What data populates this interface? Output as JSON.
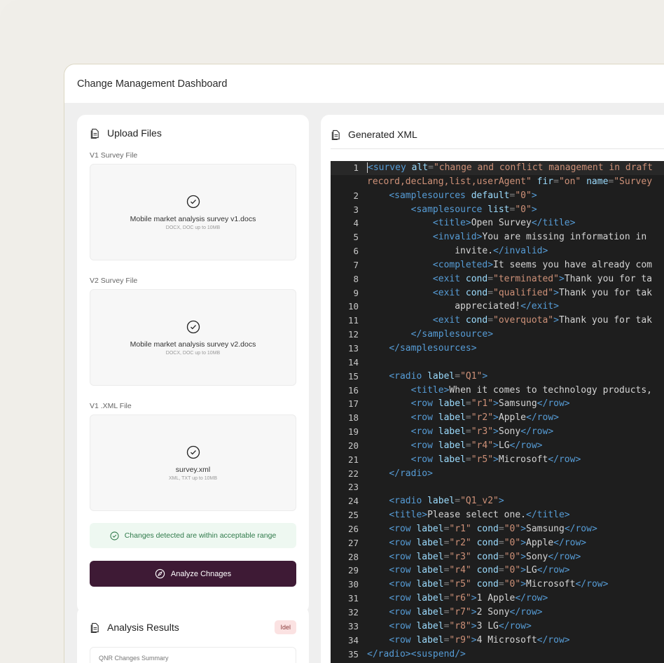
{
  "app": {
    "title": "Change Management Dashboard"
  },
  "upload": {
    "title": "Upload Files",
    "files": [
      {
        "label": "V1 Survey File",
        "name": "Mobile market analysis survey v1.docs",
        "hint": "DOCX, DOC up to 10MB"
      },
      {
        "label": "V2 Survey File",
        "name": "Mobile market analysis survey v2.docs",
        "hint": "DOCX, DOC up to 10MB"
      },
      {
        "label": "V1 .XML File",
        "name": "survey.xml",
        "hint": "XML, TXT up to 10MB"
      }
    ],
    "notice": "Changes detected are within acceptable range",
    "analyze_label": "Analyze Chnages"
  },
  "results": {
    "title": "Analysis Results",
    "badge": "Idel",
    "inner_text": "QNR Changes Summary"
  },
  "xml": {
    "title": "Generated XML",
    "lines": [
      {
        "n": "1",
        "html": "<span class='cursor'></span><span class='t'>&lt;survey</span> <span class='a'>alt</span><span class='p'>=</span><span class='s'>\"change and conflict management in draft</span>"
      },
      {
        "n": "",
        "html": "<span class='s'>record,decLang,list,userAgent\"</span> <span class='a'>fir</span><span class='p'>=</span><span class='s'>\"on\"</span> <span class='a'>name</span><span class='p'>=</span><span class='s'>\"Survey</span>"
      },
      {
        "n": "2",
        "html": "    <span class='t'>&lt;samplesources</span> <span class='a'>default</span><span class='p'>=</span><span class='s'>\"0\"</span><span class='t'>&gt;</span>"
      },
      {
        "n": "3",
        "html": "        <span class='t'>&lt;samplesource</span> <span class='a'>list</span><span class='p'>=</span><span class='s'>\"0\"</span><span class='t'>&gt;</span>"
      },
      {
        "n": "4",
        "html": "            <span class='t'>&lt;title&gt;</span><span class='x'>Open Survey</span><span class='t'>&lt;/title&gt;</span>"
      },
      {
        "n": "5",
        "html": "            <span class='t'>&lt;invalid&gt;</span><span class='x'>You are missing information in</span>"
      },
      {
        "n": "6",
        "html": "                <span class='x'>invite.</span><span class='t'>&lt;/invalid&gt;</span>"
      },
      {
        "n": "7",
        "html": "            <span class='t'>&lt;completed&gt;</span><span class='x'>It seems you have already com</span>"
      },
      {
        "n": "8",
        "html": "            <span class='t'>&lt;exit</span> <span class='a'>cond</span><span class='p'>=</span><span class='s'>\"terminated\"</span><span class='t'>&gt;</span><span class='x'>Thank you for ta</span>"
      },
      {
        "n": "9",
        "html": "            <span class='t'>&lt;exit</span> <span class='a'>cond</span><span class='p'>=</span><span class='s'>\"qualified\"</span><span class='t'>&gt;</span><span class='x'>Thank you for tak</span>"
      },
      {
        "n": "10",
        "html": "                <span class='x'>appreciated!</span><span class='t'>&lt;/exit&gt;</span>"
      },
      {
        "n": "11",
        "html": "            <span class='t'>&lt;exit</span> <span class='a'>cond</span><span class='p'>=</span><span class='s'>\"overquota\"</span><span class='t'>&gt;</span><span class='x'>Thank you for tak</span>"
      },
      {
        "n": "12",
        "html": "        <span class='t'>&lt;/samplesource&gt;</span>"
      },
      {
        "n": "13",
        "html": "    <span class='t'>&lt;/samplesources&gt;</span>"
      },
      {
        "n": "14",
        "html": ""
      },
      {
        "n": "15",
        "html": "    <span class='t'>&lt;radio</span> <span class='a'>label</span><span class='p'>=</span><span class='s'>\"Q1\"</span><span class='t'>&gt;</span>"
      },
      {
        "n": "16",
        "html": "        <span class='t'>&lt;title&gt;</span><span class='x'>When it comes to technology products,</span>"
      },
      {
        "n": "17",
        "html": "        <span class='t'>&lt;row</span> <span class='a'>label</span><span class='p'>=</span><span class='s'>\"r1\"</span><span class='t'>&gt;</span><span class='x'>Samsung</span><span class='t'>&lt;/row&gt;</span>"
      },
      {
        "n": "18",
        "html": "        <span class='t'>&lt;row</span> <span class='a'>label</span><span class='p'>=</span><span class='s'>\"r2\"</span><span class='t'>&gt;</span><span class='x'>Apple</span><span class='t'>&lt;/row&gt;</span>"
      },
      {
        "n": "19",
        "html": "        <span class='t'>&lt;row</span> <span class='a'>label</span><span class='p'>=</span><span class='s'>\"r3\"</span><span class='t'>&gt;</span><span class='x'>Sony</span><span class='t'>&lt;/row&gt;</span>"
      },
      {
        "n": "20",
        "html": "        <span class='t'>&lt;row</span> <span class='a'>label</span><span class='p'>=</span><span class='s'>\"r4\"</span><span class='t'>&gt;</span><span class='x'>LG</span><span class='t'>&lt;/row&gt;</span>"
      },
      {
        "n": "21",
        "html": "        <span class='t'>&lt;row</span> <span class='a'>label</span><span class='p'>=</span><span class='s'>\"r5\"</span><span class='t'>&gt;</span><span class='x'>Microsoft</span><span class='t'>&lt;/row&gt;</span>"
      },
      {
        "n": "22",
        "html": "    <span class='t'>&lt;/radio&gt;</span>"
      },
      {
        "n": "23",
        "html": ""
      },
      {
        "n": "24",
        "html": "    <span class='t'>&lt;radio</span> <span class='a'>label</span><span class='p'>=</span><span class='s'>\"Q1_v2\"</span><span class='t'>&gt;</span>"
      },
      {
        "n": "25",
        "html": "    <span class='t'>&lt;title&gt;</span><span class='x'>Please select one.</span><span class='t'>&lt;/title&gt;</span>"
      },
      {
        "n": "26",
        "html": "    <span class='t'>&lt;row</span> <span class='a'>label</span><span class='p'>=</span><span class='s'>\"r1\"</span> <span class='a'>cond</span><span class='p'>=</span><span class='s'>\"0\"</span><span class='t'>&gt;</span><span class='x'>Samsung</span><span class='t'>&lt;/row&gt;</span>"
      },
      {
        "n": "27",
        "html": "    <span class='t'>&lt;row</span> <span class='a'>label</span><span class='p'>=</span><span class='s'>\"r2\"</span> <span class='a'>cond</span><span class='p'>=</span><span class='s'>\"0\"</span><span class='t'>&gt;</span><span class='x'>Apple</span><span class='t'>&lt;/row&gt;</span>"
      },
      {
        "n": "28",
        "html": "    <span class='t'>&lt;row</span> <span class='a'>label</span><span class='p'>=</span><span class='s'>\"r3\"</span> <span class='a'>cond</span><span class='p'>=</span><span class='s'>\"0\"</span><span class='t'>&gt;</span><span class='x'>Sony</span><span class='t'>&lt;/row&gt;</span>"
      },
      {
        "n": "29",
        "html": "    <span class='t'>&lt;row</span> <span class='a'>label</span><span class='p'>=</span><span class='s'>\"r4\"</span> <span class='a'>cond</span><span class='p'>=</span><span class='s'>\"0\"</span><span class='t'>&gt;</span><span class='x'>LG</span><span class='t'>&lt;/row&gt;</span>"
      },
      {
        "n": "30",
        "html": "    <span class='t'>&lt;row</span> <span class='a'>label</span><span class='p'>=</span><span class='s'>\"r5\"</span> <span class='a'>cond</span><span class='p'>=</span><span class='s'>\"0\"</span><span class='t'>&gt;</span><span class='x'>Microsoft</span><span class='t'>&lt;/row&gt;</span>"
      },
      {
        "n": "31",
        "html": "    <span class='t'>&lt;row</span> <span class='a'>label</span><span class='p'>=</span><span class='s'>\"r6\"</span><span class='t'>&gt;</span><span class='x'>1 Apple</span><span class='t'>&lt;/row&gt;</span>"
      },
      {
        "n": "32",
        "html": "    <span class='t'>&lt;row</span> <span class='a'>label</span><span class='p'>=</span><span class='s'>\"r7\"</span><span class='t'>&gt;</span><span class='x'>2 Sony</span><span class='t'>&lt;/row&gt;</span>"
      },
      {
        "n": "33",
        "html": "    <span class='t'>&lt;row</span> <span class='a'>label</span><span class='p'>=</span><span class='s'>\"r8\"</span><span class='t'>&gt;</span><span class='x'>3 LG</span><span class='t'>&lt;/row&gt;</span>"
      },
      {
        "n": "34",
        "html": "    <span class='t'>&lt;row</span> <span class='a'>label</span><span class='p'>=</span><span class='s'>\"r9\"</span><span class='t'>&gt;</span><span class='x'>4 Microsoft</span><span class='t'>&lt;/row&gt;</span>"
      },
      {
        "n": "35",
        "html": "<span class='t'>&lt;/radio&gt;&lt;suspend/&gt;</span>"
      }
    ]
  },
  "colors": {
    "accent": "#3e1a35",
    "success": "#2f7a4a",
    "badge_bg": "#fbe2e2",
    "code_bg": "#1e1e1e"
  }
}
